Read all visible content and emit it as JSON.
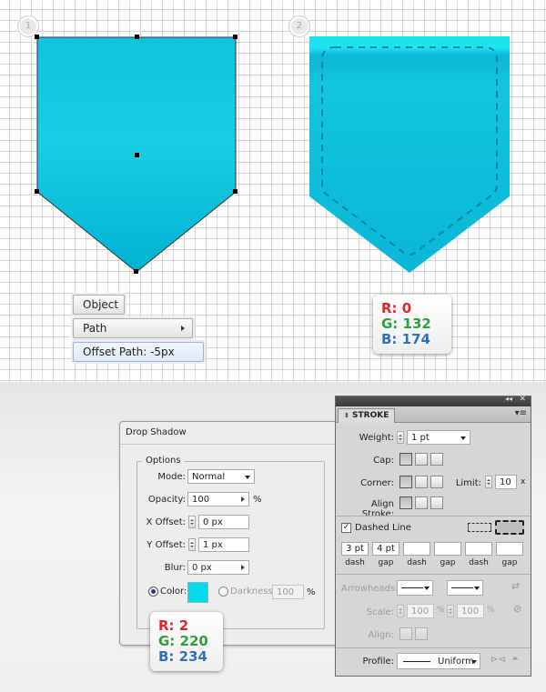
{
  "steps": {
    "one": "1",
    "two": "2"
  },
  "menu": {
    "object_label": "Object",
    "path_label": "Path",
    "offset_label": "Offset Path: -5px"
  },
  "swatch_top": {
    "r": "R: 0",
    "g": "G: 132",
    "b": "B: 174"
  },
  "swatch_bottom": {
    "r": "R: 2",
    "g": "G: 220",
    "b": "B: 234"
  },
  "drop_shadow": {
    "title": "Drop Shadow",
    "group_label": "Options",
    "mode_label": "Mode:",
    "mode_value": "Normal",
    "opacity_label": "Opacity:",
    "opacity_value": "100",
    "opacity_unit": "%",
    "x_offset_label": "X Offset:",
    "x_offset_value": "0 px",
    "y_offset_label": "Y Offset:",
    "y_offset_value": "1 px",
    "blur_label": "Blur:",
    "blur_value": "0 px",
    "color_label": "Color:",
    "color_hex": "#02dcea",
    "darkness_label": "Darkness:",
    "darkness_value": "100",
    "darkness_unit": "%"
  },
  "stroke_panel": {
    "title": "STROKE",
    "weight_label": "Weight:",
    "weight_value": "1 pt",
    "cap_label": "Cap:",
    "corner_label": "Corner:",
    "limit_label": "Limit:",
    "limit_value": "10",
    "limit_unit": "x",
    "align_label": "Align Stroke:",
    "dashed_label": "Dashed Line",
    "dashed_checked": true,
    "dash1": "3 pt",
    "gap1": "4 pt",
    "dash2": "",
    "gap2": "",
    "dash3": "",
    "gap3": "",
    "dash_caption": "dash",
    "gap_caption": "gap",
    "arrowheads_label": "Arrowheads:",
    "scale_label": "Scale:",
    "scale1": "100",
    "scale2": "100",
    "scale_unit": "%",
    "align_arrow_label": "Align:",
    "profile_label": "Profile:",
    "profile_value": "Uniform"
  },
  "colors": {
    "pocket_top": "#1fe0ee",
    "pocket_bottom": "#0fb8d6",
    "stitch": "#0084ae"
  }
}
